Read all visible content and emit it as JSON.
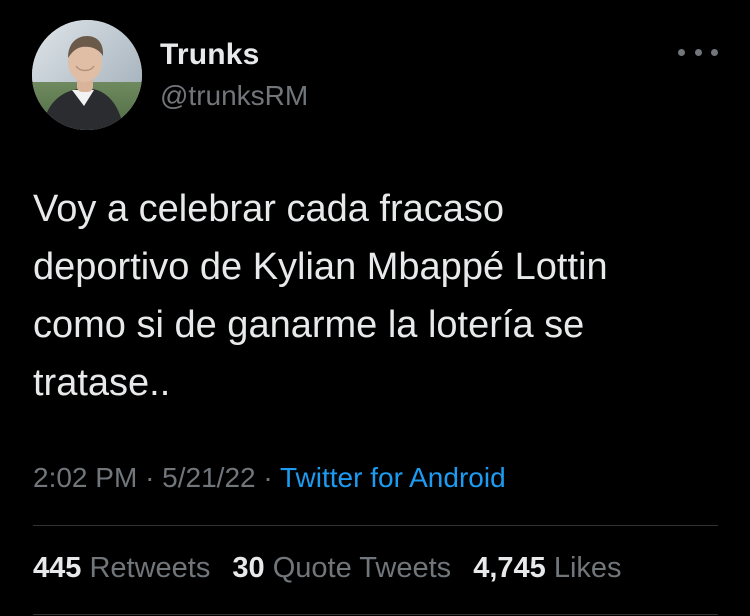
{
  "author": {
    "display_name": "Trunks",
    "handle": "@trunksRM"
  },
  "more_icon": "more-horizontal-icon",
  "tweet": {
    "lines": [
      "Voy a celebrar cada fracaso",
      "deportivo de Kylian Mbappé Lottin",
      "como si de ganarme la lotería se",
      "tratase.."
    ]
  },
  "meta": {
    "time": "2:02 PM",
    "separator": "·",
    "date": "5/21/22",
    "source": "Twitter for Android"
  },
  "stats": {
    "retweets_count": "445",
    "retweets_label": "Retweets",
    "quote_count": "30",
    "quote_label": "Quote Tweets",
    "likes_count": "4,745",
    "likes_label": "Likes"
  },
  "colors": {
    "background": "#000000",
    "text": "#e7e9ea",
    "secondary": "#71767b",
    "link": "#1d9bf0",
    "divider": "#2f3336"
  }
}
